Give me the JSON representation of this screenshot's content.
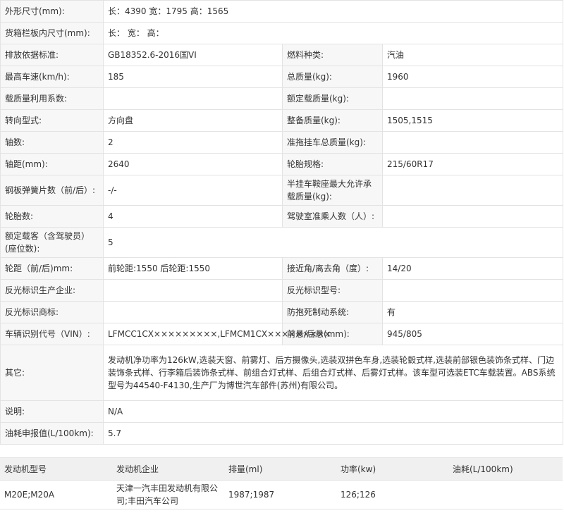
{
  "spec": {
    "rows": [
      {
        "type": "full",
        "label": "外形尺寸(mm):",
        "value": "长：4390 宽：1795 高：1565"
      },
      {
        "type": "full",
        "label": "货箱栏板内尺寸(mm):",
        "value": "长：  宽：  高："
      },
      {
        "type": "pair",
        "label1": "排放依据标准:",
        "value1": "GB18352.6-2016国VI",
        "label2": "燃料种类:",
        "value2": "汽油"
      },
      {
        "type": "pair",
        "label1": "最高车速(km/h):",
        "value1": "185",
        "label2": "总质量(kg):",
        "value2": "1960"
      },
      {
        "type": "pair",
        "label1": "载质量利用系数:",
        "value1": "",
        "label2": "额定载质量(kg):",
        "value2": ""
      },
      {
        "type": "pair",
        "label1": "转向型式:",
        "value1": "方向盘",
        "label2": "整备质量(kg):",
        "value2": "1505,1515"
      },
      {
        "type": "pair",
        "label1": "轴数:",
        "value1": "2",
        "label2": "准拖挂车总质量(kg):",
        "value2": ""
      },
      {
        "type": "pair",
        "label1": "轴距(mm):",
        "value1": "2640",
        "label2": "轮胎规格:",
        "value2": "215/60R17"
      },
      {
        "type": "pair",
        "label1": "钢板弹簧片数（前/后）:",
        "value1": "-/-",
        "label2": "半挂车鞍座最大允许承载质量(kg):",
        "value2": ""
      },
      {
        "type": "pair",
        "label1": "轮胎数:",
        "value1": "4",
        "label2": "驾驶室准乘人数（人）:",
        "value2": ""
      },
      {
        "type": "full",
        "label": "额定载客（含驾驶员）(座位数):",
        "value": "5"
      },
      {
        "type": "pair",
        "label1": "轮距（前/后)mm:",
        "value1": "前轮距:1550 后轮距:1550",
        "label2": "接近角/离去角（度）:",
        "value2": "14/20"
      },
      {
        "type": "pair",
        "label1": "反光标识生产企业:",
        "value1": "",
        "label2": "反光标识型号:",
        "value2": ""
      },
      {
        "type": "pair",
        "label1": "反光标识商标:",
        "value1": "",
        "label2": "防抱死制动系统:",
        "value2": "有"
      },
      {
        "type": "pair",
        "label1": "车辆识别代号（VIN）:",
        "value1": "LFMCC1CX×××××××××,LFMCM1CX×××××××××",
        "label2": "前悬/后悬(mm):",
        "value2": "945/805"
      },
      {
        "type": "full",
        "label": "其它:",
        "value": "发动机净功率为126kW,选装天窗、前雾灯、后方摄像头,选装双拼色车身,选装轮毂式样,选装前部银色装饰条式样、门边装饰条式样、行李箱后装饰条式样、前组合灯式样、后组合灯式样、后雾灯式样。该车型可选装ETC车载装置。ABS系统型号为44540-F4130,生产厂为博世汽车部件(苏州)有限公司。"
      },
      {
        "type": "full",
        "label": "说明:",
        "value": "N/A"
      },
      {
        "type": "full",
        "label": "油耗申报值(L/100km):",
        "value": "5.7"
      }
    ]
  },
  "engine": {
    "headers": [
      "发动机型号",
      "发动机企业",
      "排量(ml)",
      "功率(kw)",
      "油耗(L/100km)"
    ],
    "rows": [
      [
        "M20E;M20A",
        "天津一汽丰田发动机有限公司;丰田汽车公司",
        "1987;1987",
        "126;126",
        ""
      ]
    ]
  }
}
